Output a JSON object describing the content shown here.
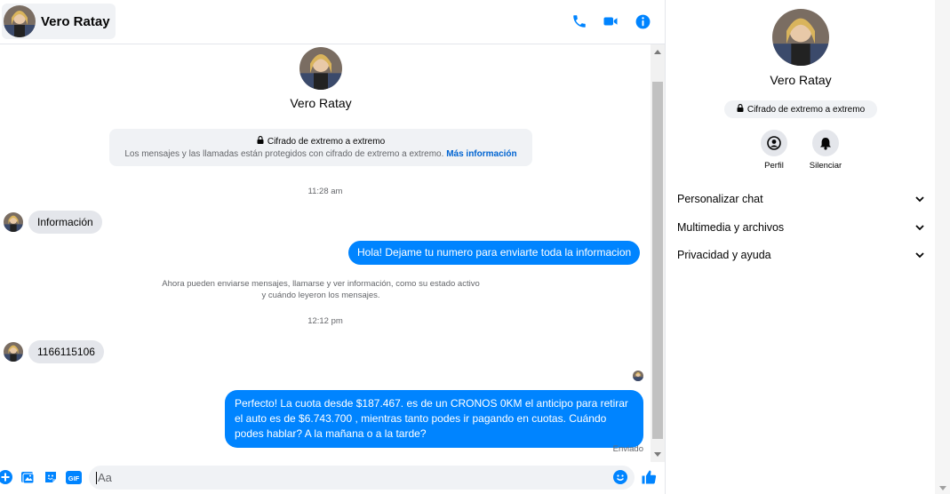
{
  "header": {
    "contact_name": "Vero Ratay",
    "icons": [
      "phone-icon",
      "video-camera-icon",
      "info-icon"
    ]
  },
  "intro": {
    "contact_name": "Vero Ratay",
    "e2e_title": "Cifrado de extremo a extremo",
    "e2e_text": "Los mensajes y las llamadas están protegidos con cifrado de extremo a extremo.",
    "e2e_link": "Más información"
  },
  "messages": {
    "time_1": "11:28 am",
    "incoming_1": "Información",
    "outgoing_1": "Hola! Dejame tu numero  para enviarte toda la informacion",
    "system_note": "Ahora pueden enviarse mensajes, llamarse y ver información, como su estado activo y cuándo leyeron los mensajes.",
    "time_2": "12:12 pm",
    "incoming_2": "1166115106",
    "outgoing_2": "Perfecto! La cuota desde $187.467. es de un CRONOS 0KM el anticipo para retirar el auto es de $6.743.700 , mientras tanto podes ir pagando en cuotas. Cuándo podes hablar? A la mañana o a la tarde?",
    "status": "Enviado"
  },
  "composer": {
    "placeholder": "Aa",
    "icons": [
      "plus-icon",
      "photo-icon",
      "sticker-icon",
      "gif-icon",
      "emoji-icon",
      "like-icon"
    ]
  },
  "info_panel": {
    "contact_name": "Vero Ratay",
    "e2e_badge": "Cifrado de extremo a extremo",
    "actions": [
      {
        "label": "Perfil",
        "icon": "profile-icon"
      },
      {
        "label": "Silenciar",
        "icon": "bell-icon"
      }
    ],
    "sections": [
      {
        "label": "Personalizar chat"
      },
      {
        "label": "Multimedia y archivos"
      },
      {
        "label": "Privacidad y ayuda"
      }
    ]
  },
  "colors": {
    "accent": "#0084ff",
    "link": "#0064d1",
    "bubble_incoming": "#e4e6eb",
    "panel_bg": "#f0f2f5"
  }
}
